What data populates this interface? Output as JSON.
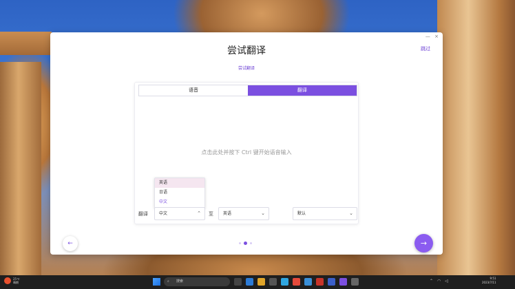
{
  "window": {
    "controls": [
      "—",
      "×"
    ]
  },
  "dialog": {
    "title": "尝试翻译",
    "skip_label": "跳过",
    "subtitle": "尝试翻译",
    "tabs": [
      {
        "label": "语音",
        "active": false
      },
      {
        "label": "翻译",
        "active": true
      }
    ],
    "hint": "点击此处并按下 Ctrl 键开始语音输入",
    "dropdown_options": [
      {
        "label": "英语",
        "state": "hover"
      },
      {
        "label": "日语",
        "state": ""
      },
      {
        "label": "中文",
        "state": "selected"
      }
    ],
    "from_label": "翻译",
    "from_value": "中文",
    "to_label": "至",
    "to_value": "英语",
    "mode_value": "默认",
    "step_total": 3,
    "step_current": 2,
    "accent": "#7b4fe0"
  },
  "taskbar": {
    "weather_temp": "25℃",
    "weather_desc": "晴朗",
    "search_placeholder": "搜索",
    "time": "9:51",
    "date": "2023/7/11"
  }
}
